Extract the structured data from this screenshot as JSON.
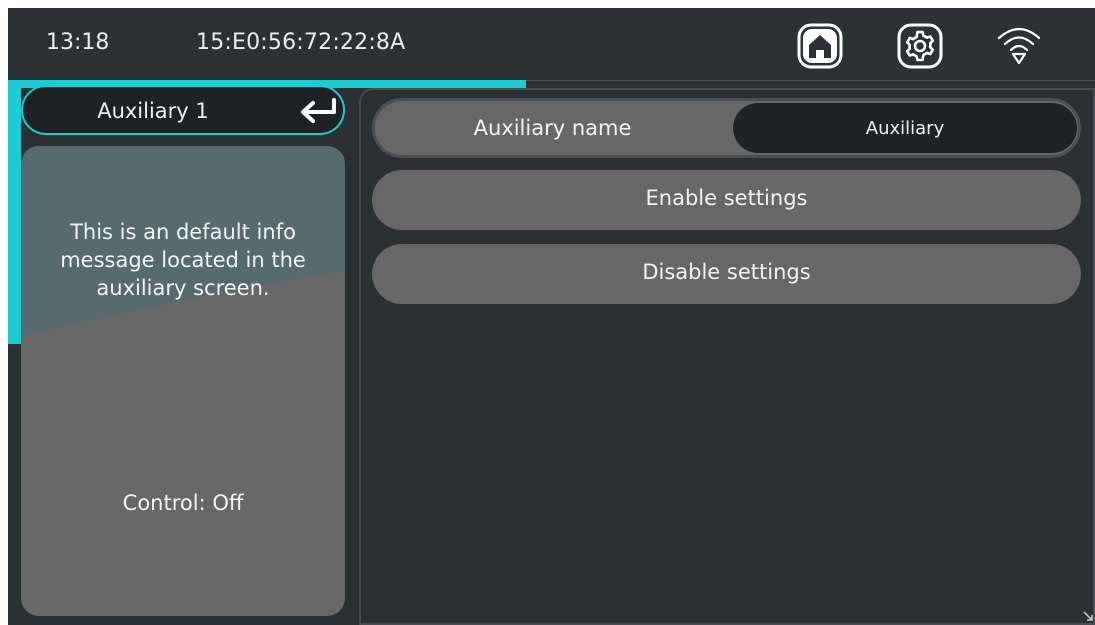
{
  "status_bar": {
    "time": "13:18",
    "device_id": "15:E0:56:72:22:8A",
    "icons": [
      "home-icon",
      "gear-icon",
      "wifi-icon"
    ]
  },
  "sidebar": {
    "title": "Auxiliary 1",
    "back_icon": "return-arrow-icon",
    "info_message": "This is an default info message located in the auxiliary screen.",
    "control_status": "Control: Off"
  },
  "main": {
    "name_label": "Auxiliary name",
    "name_value": "Auxiliary",
    "enable_label": "Enable settings",
    "disable_label": "Disable settings"
  },
  "colors": {
    "accent": "#1ccbd4",
    "background": "#2b3133",
    "card": "#676767",
    "dark_field": "#1f2325"
  }
}
